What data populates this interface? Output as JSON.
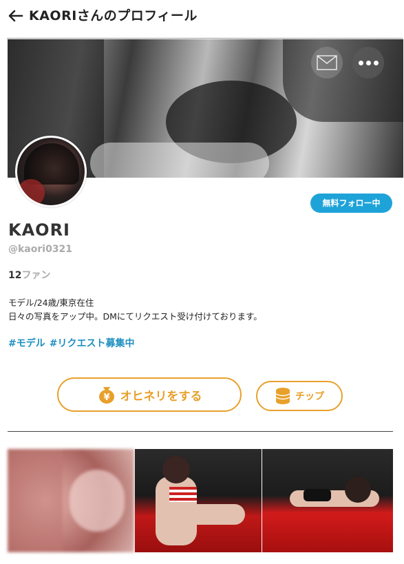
{
  "header": {
    "title": "KAORIさんのプロフィール",
    "back_icon": "arrow-left-icon"
  },
  "cover": {
    "mail_icon": "envelope-icon",
    "more_icon": "more-horizontal-icon"
  },
  "profile": {
    "follow_label": "無料フォロー中",
    "name": "KAORI",
    "handle": "@kaori0321",
    "fans_count": "12",
    "fans_label": "ファン",
    "bio_line1": "モデル/24歳/東京在住",
    "bio_line2": "日々の写真をアップ中。DMにてリクエスト受け付けております。",
    "tags": [
      "#モデル",
      "#リクエスト募集中"
    ]
  },
  "actions": {
    "ohineri_label": "オヒネリをする",
    "ohineri_icon": "money-bag-icon",
    "chip_label": "チップ",
    "chip_icon": "coin-stack-icon"
  },
  "colors": {
    "accent_blue": "#1ea3d8",
    "tag_blue": "#1e8fc0",
    "accent_orange": "#e8a02a"
  },
  "gallery": {
    "count": 3
  }
}
